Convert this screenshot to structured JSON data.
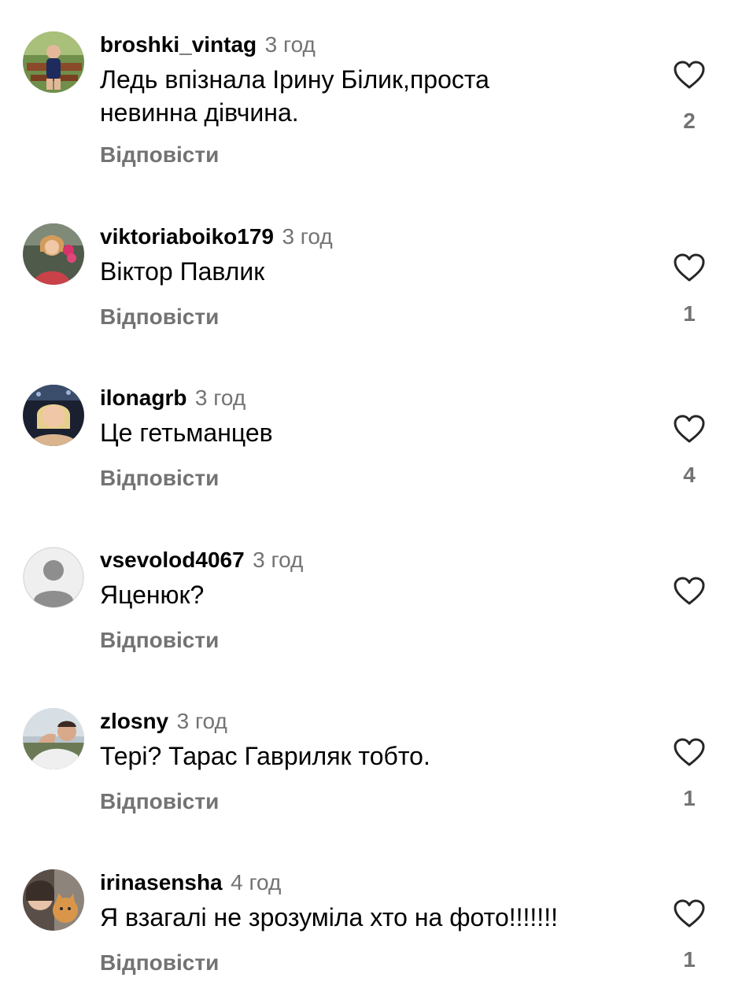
{
  "comments": [
    {
      "username": "broshki_vintag",
      "time": "3 год",
      "text_line1": "Ледь впізнала Ірину Білик,проста",
      "text_line2": "невинна дівчина.",
      "reply_label": "Відповісти",
      "likes": "2",
      "avatar_icon": "user-photo"
    },
    {
      "username": "viktoriaboiko179",
      "time": "3 год",
      "text_line1": "Віктор Павлик",
      "reply_label": "Відповісти",
      "likes": "1",
      "avatar_icon": "user-photo"
    },
    {
      "username": "ilonagrb",
      "time": "3 год",
      "text_line1": "Це гетьманцев",
      "reply_label": "Відповісти",
      "likes": "4",
      "avatar_icon": "user-photo"
    },
    {
      "username": "vsevolod4067",
      "time": "3 год",
      "text_line1": "Яценюк?",
      "reply_label": "Відповісти",
      "likes": "",
      "avatar_icon": "default-avatar-icon"
    },
    {
      "username": "zlosny",
      "time": "3 год",
      "text_line1": "Тері? Тарас Гавриляк тобто.",
      "reply_label": "Відповісти",
      "likes": "1",
      "avatar_icon": "user-photo"
    },
    {
      "username": "irinasensha",
      "time": "4 год",
      "text_line1": "Я взагалі не зрозуміла хто на фото!!!!!!!",
      "reply_label": "Відповісти",
      "likes": "1",
      "avatar_icon": "user-photo"
    }
  ],
  "icons": {
    "like": "heart-outline-icon"
  },
  "colors": {
    "secondary_text": "#737373",
    "primary_text": "#000000"
  }
}
